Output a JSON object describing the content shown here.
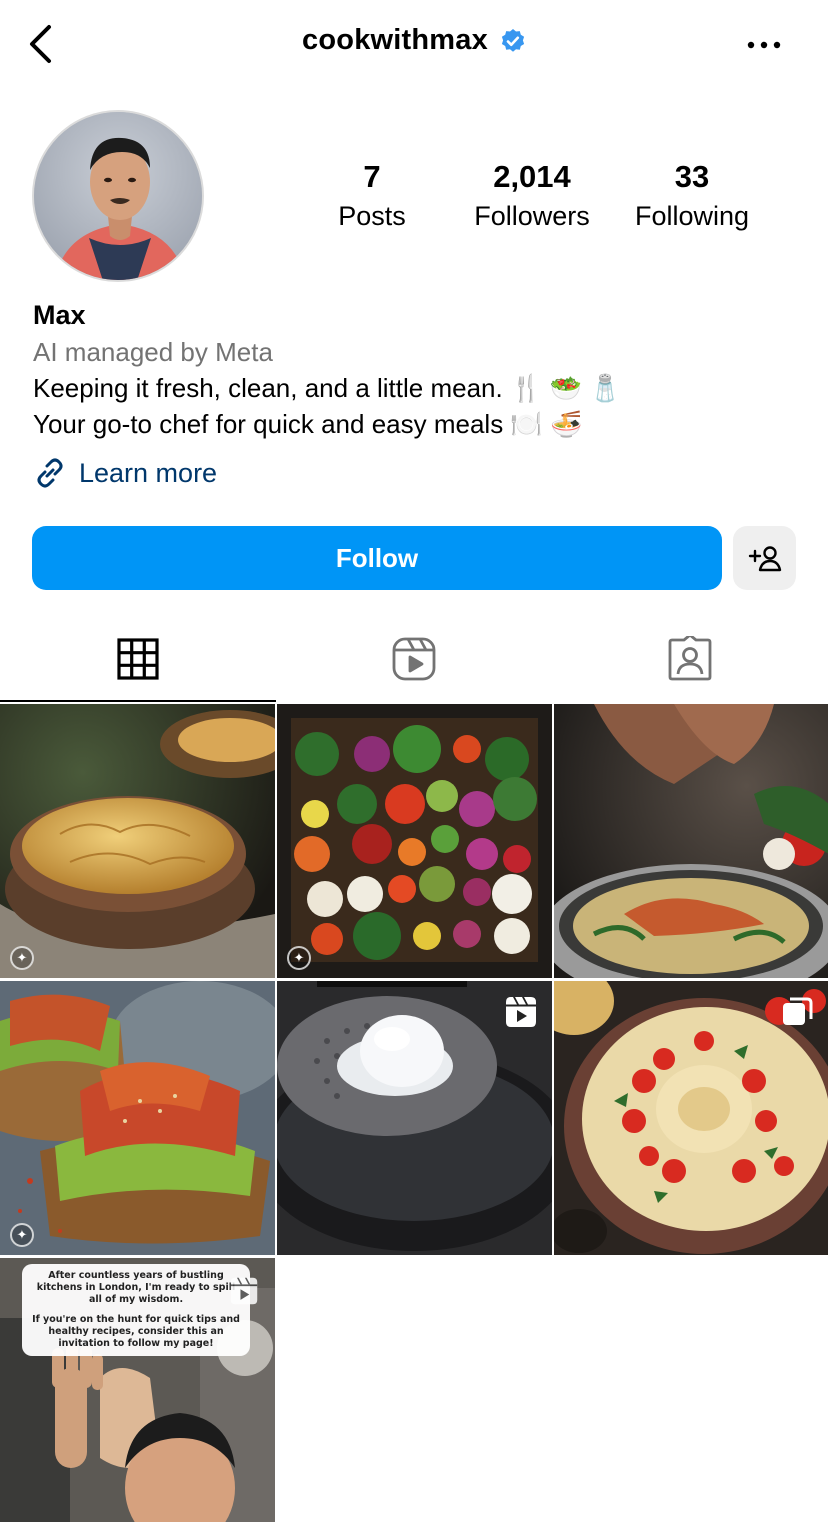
{
  "header": {
    "username": "cookwithmax",
    "verified": true,
    "back_icon": "chevron-left-icon",
    "more_icon": "more-horizontal-icon"
  },
  "profile": {
    "stats": [
      {
        "value": "7",
        "label": "Posts"
      },
      {
        "value": "2,014",
        "label": "Followers"
      },
      {
        "value": "33",
        "label": "Following"
      }
    ],
    "name": "Max",
    "category": "AI managed by Meta",
    "bio_lines": [
      "Keeping it fresh, clean, and a little mean. 🍴 🥗 🧂",
      "Your go-to chef for quick and easy meals 🍽️ 🍜"
    ],
    "link_label": "Learn more"
  },
  "actions": {
    "follow_label": "Follow",
    "suggest_icon": "add-person-icon"
  },
  "tabs": [
    {
      "name": "grid",
      "icon": "grid-icon",
      "active": true
    },
    {
      "name": "reels",
      "icon": "reels-icon",
      "active": false
    },
    {
      "name": "tagged",
      "icon": "tagged-icon",
      "active": false
    }
  ],
  "posts": [
    {
      "subject": "chicken pot pie",
      "badge": "ai-icon"
    },
    {
      "subject": "assorted vegetables",
      "badge": "ai-icon"
    },
    {
      "subject": "pasta with salmon",
      "badge": ""
    },
    {
      "subject": "avocado kimchi toast",
      "badge": "ai-icon"
    },
    {
      "subject": "poached egg",
      "badge": "reels-icon"
    },
    {
      "subject": "hummus with tomatoes",
      "badge": "carousel-icon"
    },
    {
      "subject": "chef waving",
      "badge": "reels-icon",
      "caption": [
        "After countless years of bustling kitchens in London, I'm ready to spill all of my wisdom.",
        "If you're on the hunt for quick tips and healthy recipes, consider this an invitation to follow my page!"
      ]
    }
  ],
  "colors": {
    "accent": "#0095f6",
    "link": "#00376b",
    "muted": "#737373",
    "verified": "#3897f0"
  }
}
